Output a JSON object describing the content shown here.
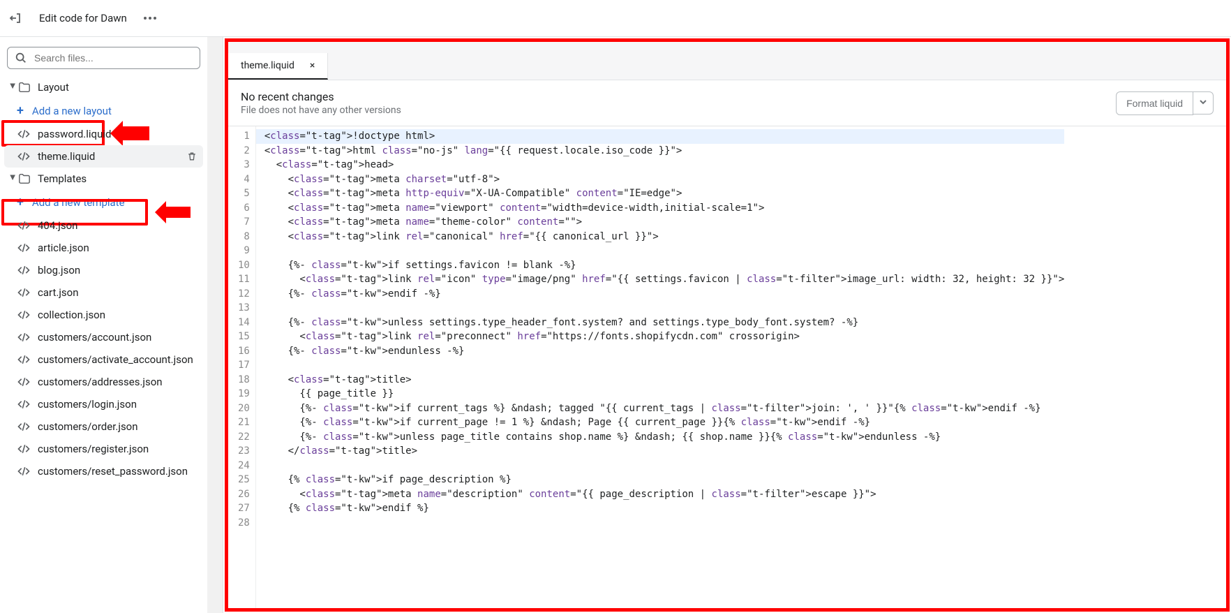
{
  "topbar": {
    "title": "Edit code for Dawn"
  },
  "search": {
    "placeholder": "Search files..."
  },
  "sidebar": {
    "folders": [
      {
        "label": "Layout",
        "add_label": "Add a new layout",
        "files": [
          {
            "label": "password.liquid"
          },
          {
            "label": "theme.liquid",
            "active": true
          }
        ]
      },
      {
        "label": "Templates",
        "add_label": "Add a new template",
        "files": [
          {
            "label": "404.json"
          },
          {
            "label": "article.json"
          },
          {
            "label": "blog.json"
          },
          {
            "label": "cart.json"
          },
          {
            "label": "collection.json"
          },
          {
            "label": "customers/account.json"
          },
          {
            "label": "customers/activate_account.json"
          },
          {
            "label": "customers/addresses.json"
          },
          {
            "label": "customers/login.json"
          },
          {
            "label": "customers/order.json"
          },
          {
            "label": "customers/register.json"
          },
          {
            "label": "customers/reset_password.json"
          }
        ]
      }
    ]
  },
  "tabs": [
    {
      "label": "theme.liquid"
    }
  ],
  "status": {
    "title": "No recent changes",
    "sub": "File does not have any other versions",
    "format_btn": "Format liquid"
  },
  "code": {
    "lines": [
      "<!doctype html>",
      "<html class=\"no-js\" lang=\"{{ request.locale.iso_code }}\">",
      "  <head>",
      "    <meta charset=\"utf-8\">",
      "    <meta http-equiv=\"X-UA-Compatible\" content=\"IE=edge\">",
      "    <meta name=\"viewport\" content=\"width=device-width,initial-scale=1\">",
      "    <meta name=\"theme-color\" content=\"\">",
      "    <link rel=\"canonical\" href=\"{{ canonical_url }}\">",
      "",
      "    {%- if settings.favicon != blank -%}",
      "      <link rel=\"icon\" type=\"image/png\" href=\"{{ settings.favicon | image_url: width: 32, height: 32 }}\">",
      "    {%- endif -%}",
      "",
      "    {%- unless settings.type_header_font.system? and settings.type_body_font.system? -%}",
      "      <link rel=\"preconnect\" href=\"https://fonts.shopifycdn.com\" crossorigin>",
      "    {%- endunless -%}",
      "",
      "    <title>",
      "      {{ page_title }}",
      "      {%- if current_tags %} &ndash; tagged \"{{ current_tags | join: ', ' }}\"{% endif -%}",
      "      {%- if current_page != 1 %} &ndash; Page {{ current_page }}{% endif -%}",
      "      {%- unless page_title contains shop.name %} &ndash; {{ shop.name }}{% endunless -%}",
      "    </title>",
      "",
      "    {% if page_description %}",
      "      <meta name=\"description\" content=\"{{ page_description | escape }}\">",
      "    {% endif %}",
      ""
    ]
  }
}
